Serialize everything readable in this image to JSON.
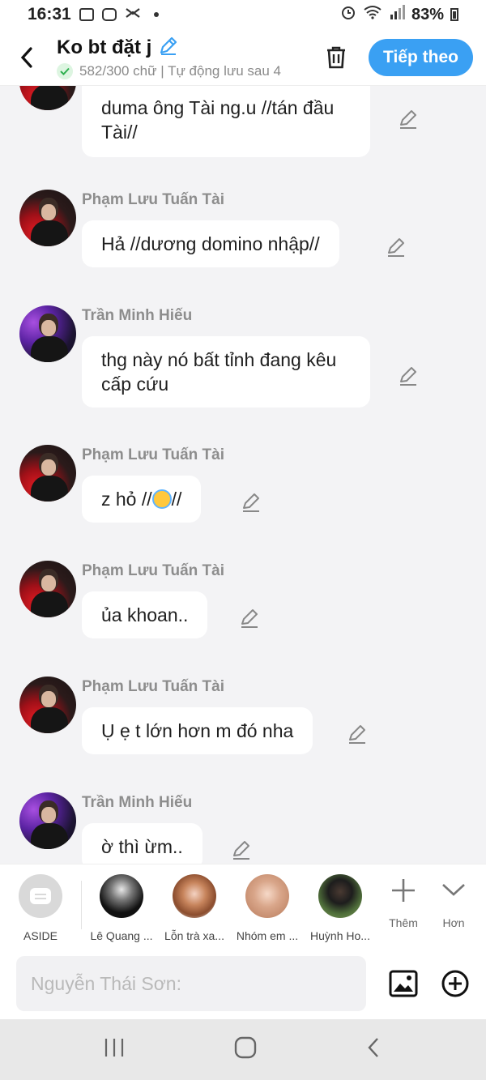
{
  "status_bar": {
    "time": "16:31",
    "battery": "83%"
  },
  "header": {
    "title": "Ko bt đặt j",
    "subtitle": "582/300 chữ | Tự động lưu sau 4",
    "next_label": "Tiếp theo"
  },
  "messages": [
    {
      "sender": "",
      "text": "duma ông Tài ng.u //tán đầu Tài//",
      "avatar": "red"
    },
    {
      "sender": "Phạm Lưu Tuấn Tài",
      "text": "Hả //dương domino nhập//",
      "avatar": "red"
    },
    {
      "sender": "Trần Minh Hiếu",
      "text": "thg này nó bất tỉnh đang kêu cấp cứu",
      "avatar": "purple"
    },
    {
      "sender": "Phạm Lưu Tuấn Tài",
      "text_before": "z hỏ //",
      "emoji": "smiling-face-with-halo-emoji",
      "text_after": "//",
      "avatar": "red"
    },
    {
      "sender": "Phạm Lưu Tuấn Tài",
      "text": "ủa khoan..",
      "avatar": "red"
    },
    {
      "sender": "Phạm Lưu Tuấn Tài",
      "text": "Ụ ẹ t lớn hơn m đó nha",
      "avatar": "red"
    },
    {
      "sender": "Trần Minh Hiếu",
      "text": "ờ thì ừm..",
      "avatar": "purple"
    }
  ],
  "contacts": [
    {
      "name": "ASIDE"
    },
    {
      "name": "Lê Quang ..."
    },
    {
      "name": "Lỗn trà xa..."
    },
    {
      "name": "Nhóm em ..."
    },
    {
      "name": "Huỳnh Ho..."
    }
  ],
  "more": {
    "add_label": "Thêm",
    "more_label": "Hơn"
  },
  "input": {
    "placeholder": "Nguyễn Thái Sơn:"
  },
  "colors": {
    "accent": "#3aa0f3",
    "background": "#f3f3f5",
    "bubble": "#ffffff",
    "check_green": "#2fb050"
  }
}
